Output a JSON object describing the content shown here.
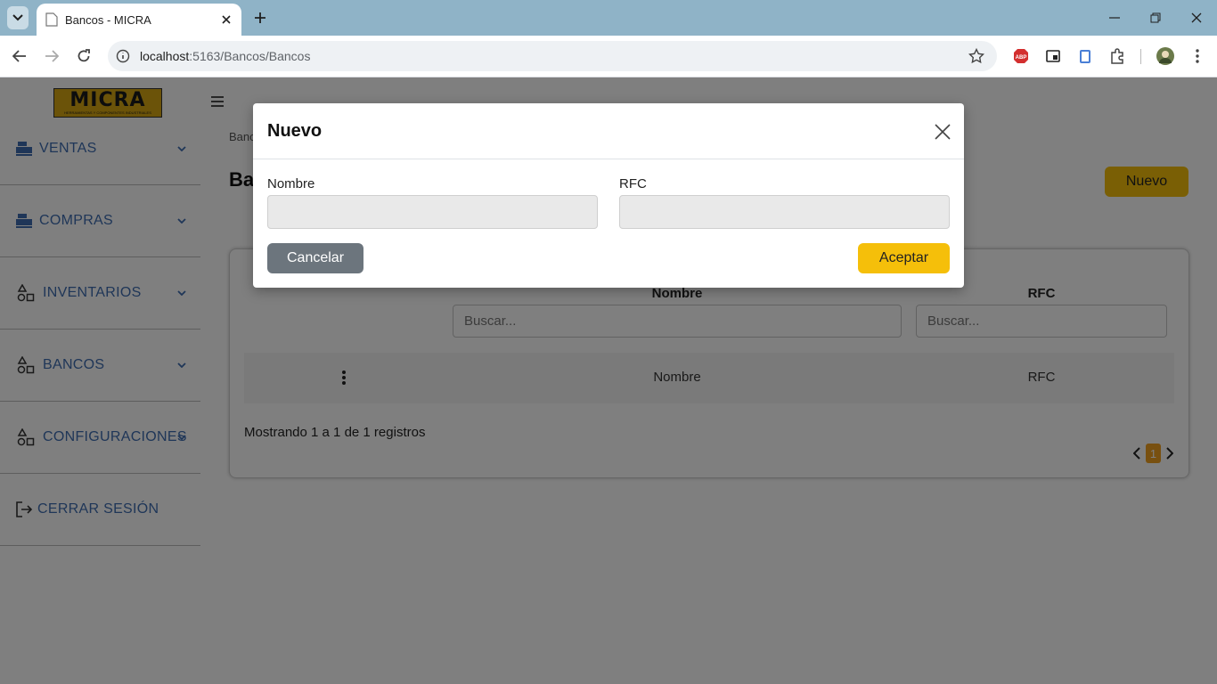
{
  "browser": {
    "tab_title": "Bancos - MICRA",
    "url_host": "localhost",
    "url_path": ":5163/Bancos/Bancos",
    "extensions": [
      "abp-icon",
      "pip-icon",
      "clipboard-icon",
      "puzzle-icon",
      "avatar"
    ]
  },
  "sidebar": {
    "logo_text": "MICRA",
    "logo_subtext": "HERRAMIENTAS Y COMPONENTES INDUSTRIALES",
    "items": [
      {
        "label": "VENTAS",
        "icon": "register-icon"
      },
      {
        "label": "COMPRAS",
        "icon": "register-icon"
      },
      {
        "label": "INVENTARIOS",
        "icon": "shapes-icon"
      },
      {
        "label": "BANCOS",
        "icon": "shapes-icon"
      },
      {
        "label": "CONFIGURACIONES",
        "icon": "shapes-icon"
      },
      {
        "label": "CERRAR SESIÓN",
        "icon": "logout-icon"
      }
    ]
  },
  "main": {
    "breadcrumb": "Bancos",
    "title": "Bancos",
    "new_button": "Nuevo",
    "table": {
      "columns": [
        "Nombre",
        "RFC"
      ],
      "search_placeholder": "Buscar...",
      "rows": [
        {
          "nombre": "Nombre",
          "rfc": "RFC"
        }
      ],
      "records_text": "Mostrando 1 a 1 de 1 registros",
      "current_page": "1"
    }
  },
  "modal": {
    "title": "Nuevo",
    "field_nombre_label": "Nombre",
    "field_rfc_label": "RFC",
    "field_nombre_value": "",
    "field_rfc_value": "",
    "cancel_label": "Cancelar",
    "accept_label": "Aceptar"
  },
  "colors": {
    "accent": "#f5bf0a",
    "sidebar_text": "#3e6db0",
    "tabbar": "#8fb3c7",
    "cancel": "#6c757d"
  }
}
